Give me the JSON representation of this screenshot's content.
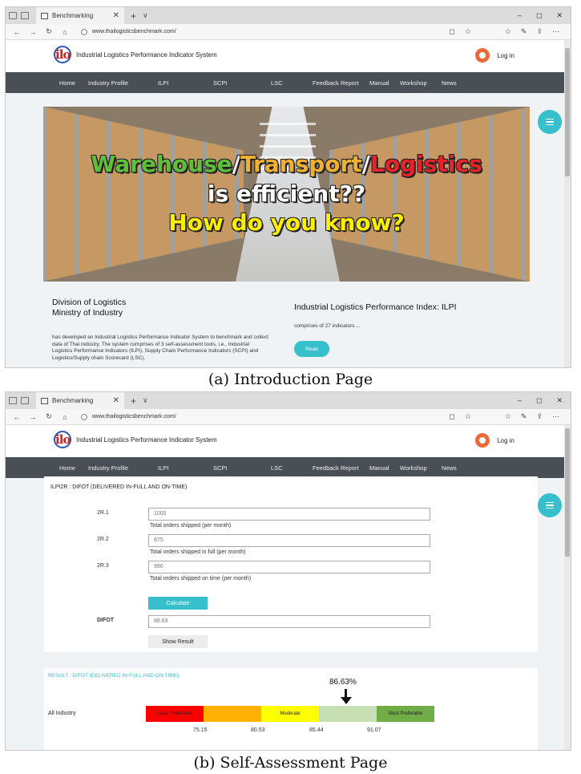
{
  "browser": {
    "tab_title": "Benchmarking",
    "tab_close": "✕",
    "new_tab": "+",
    "tab_more": "∨",
    "url": "www.thailogisticsbenchmark.com/",
    "win_min": "–",
    "win_max": "◻",
    "win_close": "✕",
    "nav": {
      "back": "←",
      "forward": "→",
      "refresh": "↻",
      "home": "⌂"
    },
    "tools": {
      "reading": "◻",
      "favorite": "☆",
      "favorites_hub": "☆",
      "notes": "✎",
      "share": "⇪",
      "more": "⋯"
    }
  },
  "site": {
    "logo_text": "ilo",
    "title": "Industrial Logistics Performance Indicator System",
    "login": "Log in",
    "nav": [
      "Home",
      "Industry Profile",
      "ILPI",
      "SCPI",
      "LSC",
      "Feedback Report",
      "Manual",
      "Workshop",
      "News"
    ]
  },
  "intro": {
    "hero": {
      "word1": "Warehouse",
      "word2": "Transport",
      "word3": "Logistics",
      "slash": "/",
      "line2": "is efficient??",
      "line3": "How do you know?"
    },
    "org_line1": "Division of Logistics",
    "org_line2": "Ministry of Industry",
    "description": "has developed an Industrial Logistics Performance Indicator System to benchmark and collect data of Thai industry.  The system comprises of 3 self-assessment tools, i.e., Industrial Logistics Performance Indicators (ILPI), Supply Chain Performance Indicators (SCPI) and Logistics/Supply chain Scorecard (LSC).",
    "ilpi_title": "Industrial Logistics Performance Index: ILPI",
    "ilpi_sub": "comprises of 27 indicators ...",
    "read_button": "Read"
  },
  "captions": {
    "a": "(a) Introduction Page",
    "b": "(b) Self-Assessment Page"
  },
  "assessment": {
    "heading": "ILPI2R : DIFOT (DELIVERED IN-FULL AND ON-TIME)",
    "rows": [
      {
        "code": "2R.1",
        "value": "1000",
        "hint": "Total orders shipped (per month)"
      },
      {
        "code": "2R.2",
        "value": "875",
        "hint": "Total orders shipped in full (per month)"
      },
      {
        "code": "2R.3",
        "value": "990",
        "hint": "Total orders shipped on time (per month)"
      }
    ],
    "calculate": "Calculate",
    "difot_label": "DIFOT",
    "difot_value": "86.63",
    "show_result": "Show Result"
  },
  "result": {
    "heading": "RESULT : DIFOT (DELIVERED IN-FULL AND ON-TIME)",
    "percent": "86.63%",
    "row_label": "All Industry",
    "segments": [
      {
        "label": "Least Preferable",
        "color": "#ff0000"
      },
      {
        "label": "",
        "color": "#ffb000"
      },
      {
        "label": "Moderate",
        "color": "#ffff00"
      },
      {
        "label": "",
        "color": "#c6e0b4"
      },
      {
        "label": "Most Preferable",
        "color": "#70ad47"
      }
    ],
    "ticks": [
      "75.15",
      "80.53",
      "85.44",
      "91.07"
    ]
  },
  "colors": {
    "accent": "#37c0cc",
    "navbar": "#4a4f55"
  }
}
